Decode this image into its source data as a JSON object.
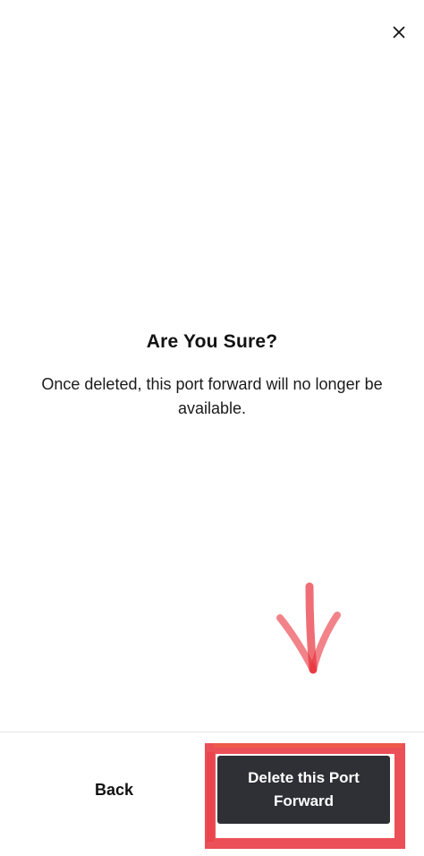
{
  "dialog": {
    "title": "Are You Sure?",
    "message": "Once deleted, this port forward will no longer be available."
  },
  "actions": {
    "back_label": "Back",
    "delete_label": "Delete this Port Forward"
  },
  "icons": {
    "close": "close-icon",
    "annotation": "arrow-down-annotation"
  },
  "colors": {
    "primary_button": "#2f2f36",
    "annotation": "#e8303a",
    "background": "#ffffff"
  }
}
